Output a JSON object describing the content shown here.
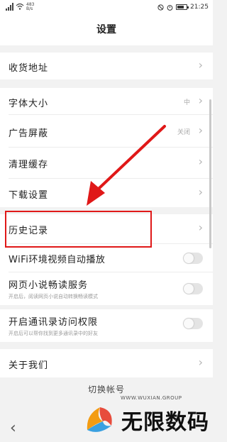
{
  "status_bar": {
    "net_speed": "483",
    "net_unit": "B/s",
    "time": "21:25",
    "battery_level": 0.75
  },
  "page": {
    "title": "设置"
  },
  "settings": {
    "address": {
      "label": "收货地址"
    },
    "font_size": {
      "label": "字体大小",
      "value": "中"
    },
    "ad_block": {
      "label": "广告屏蔽",
      "value": "关闭"
    },
    "clear_cache": {
      "label": "清理缓存"
    },
    "download": {
      "label": "下载设置"
    },
    "history": {
      "label": "历史记录"
    },
    "wifi_autoplay": {
      "label": "WiFi环境视频自动播放",
      "enabled": false
    },
    "web_novel": {
      "label": "网页小说畅读服务",
      "description": "开启后，阅读网页小说自动转换畅读模式",
      "enabled": false
    },
    "contacts": {
      "label": "开启通讯录访问权限",
      "description": "开启后可以帮你找到更多通讯录中的好友",
      "enabled": false
    },
    "about": {
      "label": "关于我们"
    }
  },
  "switch_account": "切换帐号",
  "watermark": {
    "name": "无限数码",
    "url": "WWW.WUXIAN.GROUP"
  },
  "colors": {
    "highlight": "#e01818",
    "page_bg": "#f2f2f2"
  }
}
